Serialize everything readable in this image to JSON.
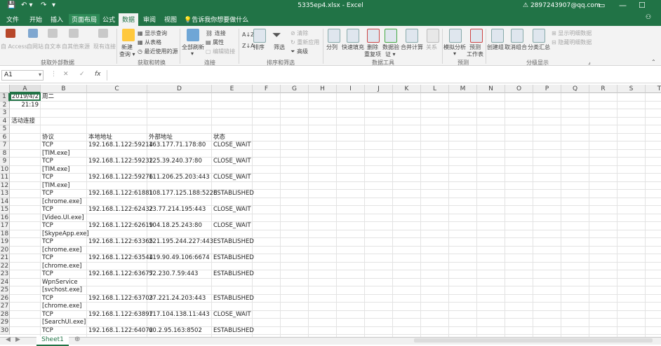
{
  "window": {
    "title": "5335ep4.xlsx - Excel",
    "account": "2897243907@qq.com",
    "quick_access": [
      "💾",
      "↶ ▾",
      "↷",
      "▾"
    ],
    "controls": [
      "▭",
      "—",
      "☐"
    ]
  },
  "tabs": [
    {
      "label": "文件"
    },
    {
      "label": "开始"
    },
    {
      "label": "插入"
    },
    {
      "label": "页面布局"
    },
    {
      "label": "公式"
    },
    {
      "label": "数据"
    },
    {
      "label": "审阅"
    },
    {
      "label": "视图"
    }
  ],
  "tellme": "告诉我你想要做什么",
  "ribbon": {
    "get_external": {
      "buttons": [
        "自 Access",
        "自网站",
        "自文本",
        "自其他来源",
        "现有连接"
      ],
      "group": "获取外部数据"
    },
    "transform": {
      "new_query": "新建",
      "new_query2": "查询 ▾",
      "show_query": "显示查询",
      "from_table": "从表格",
      "recent": "最近使用的源",
      "group": "获取和转换"
    },
    "connections": {
      "refresh_all": "全部刷新",
      "refresh_all2": "▾",
      "connections": "连接",
      "properties": "属性",
      "edit_links": "编辑链接",
      "group": "连接"
    },
    "sort_filter": {
      "sort": "排序",
      "filter": "筛选",
      "clear": "清除",
      "reapply": "重新应用",
      "advanced": "高级",
      "group": "排序和筛选"
    },
    "data_tools": {
      "split": "分列",
      "flash_fill": "快速填充",
      "remove_dup": "删除",
      "remove_dup2": "重复项",
      "validation": "数据验",
      "validation2": "证 ▾",
      "consolidate": "合并计算",
      "relationships": "关系",
      "group": "数据工具"
    },
    "forecast": {
      "what_if": "模拟分析",
      "what_if2": "▾",
      "forecast_sheet": "预测",
      "forecast_sheet2": "工作表",
      "group": "预测"
    },
    "outline": {
      "group_btn": "创建组",
      "ungroup": "取消组合",
      "subtotal": "分类汇总",
      "show_detail": "显示明细数据",
      "hide_detail": "隐藏明细数据",
      "group": "分级显示"
    }
  },
  "formula_bar": {
    "name_box": "A1",
    "fx": "fx",
    "cancel": "✕",
    "enter": "✓"
  },
  "columns": [
    "A",
    "B",
    "C",
    "D",
    "E",
    "F",
    "G",
    "H",
    "I",
    "J",
    "K",
    "L",
    "M",
    "N",
    "O",
    "P",
    "Q",
    "R",
    "S",
    "T"
  ],
  "rows": [
    "1",
    "2",
    "3",
    "4",
    "5",
    "6",
    "7",
    "8",
    "9",
    "10",
    "11",
    "12",
    "13",
    "14",
    "15",
    "16",
    "17",
    "18",
    "19",
    "20",
    "21",
    "22",
    "23",
    "24",
    "25",
    "26",
    "27",
    "28",
    "29",
    "30"
  ],
  "cells": {
    "A1": "2019/4/2",
    "B1": "周二",
    "A2": "21:19",
    "A4": "活动连接",
    "B6": "协议",
    "C6": "本地地址",
    "D6": "外部地址",
    "E6": "状态",
    "B7": "TCP",
    "C7": "192.168.1.122:59214",
    "D7": "163.177.71.178:80",
    "E7": "CLOSE_WAIT",
    "B8": "[TIM.exe]",
    "B9": "TCP",
    "C9": "192.168.1.122:59232",
    "D9": "125.39.240.37:80",
    "E9": "CLOSE_WAIT",
    "B10": "[TIM.exe]",
    "B11": "TCP",
    "C11": "192.168.1.122:59276",
    "D11": "111.206.25.203:443",
    "E11": "CLOSE_WAIT",
    "B12": "[TIM.exe]",
    "B13": "TCP",
    "C13": "192.168.1.122:61881",
    "D13": "108.177.125.188:5228",
    "E13": "ESTABLISHED",
    "B14": "[chrome.exe]",
    "B15": "TCP",
    "C15": "192.168.1.122:62432",
    "D15": "23.77.214.195:443",
    "E15": "CLOSE_WAIT",
    "B16": "[Video.UI.exe]",
    "B17": "TCP",
    "C17": "192.168.1.122:62619",
    "D17": "104.18.25.243:80",
    "E17": "CLOSE_WAIT",
    "B18": "[SkypeApp.exe]",
    "B19": "TCP",
    "C19": "192.168.1.122:63365",
    "D19": "221.195.244.227:443",
    "E19": "ESTABLISHED",
    "B20": "[chrome.exe]",
    "B21": "TCP",
    "C21": "192.168.1.122:63544",
    "D21": "119.90.49.106:6674",
    "E21": "ESTABLISHED",
    "B22": "[chrome.exe]",
    "B23": "TCP",
    "C23": "192.168.1.122:63677",
    "D23": "52.230.7.59:443",
    "E23": "ESTABLISHED",
    "B24": "WpnService",
    "B25": "[svchost.exe]",
    "B26": "TCP",
    "C26": "192.168.1.122:63703",
    "D26": "27.221.24.203:443",
    "E26": "ESTABLISHED",
    "B27": "[chrome.exe]",
    "B28": "TCP",
    "C28": "192.168.1.122:63897",
    "D28": "117.104.138.11:443",
    "E28": "CLOSE_WAIT",
    "B29": "[SearchUI.exe]",
    "B30": "TCP",
    "C30": "192.168.1.122:64072",
    "D30": "60.2.95.163:8502",
    "E30": "ESTABLISHED"
  },
  "sheet_tab": "Sheet1",
  "colors": {
    "accent": "#217346",
    "ribbon_bg": "#f3f3f3",
    "grid_line": "#e3e3e3"
  }
}
